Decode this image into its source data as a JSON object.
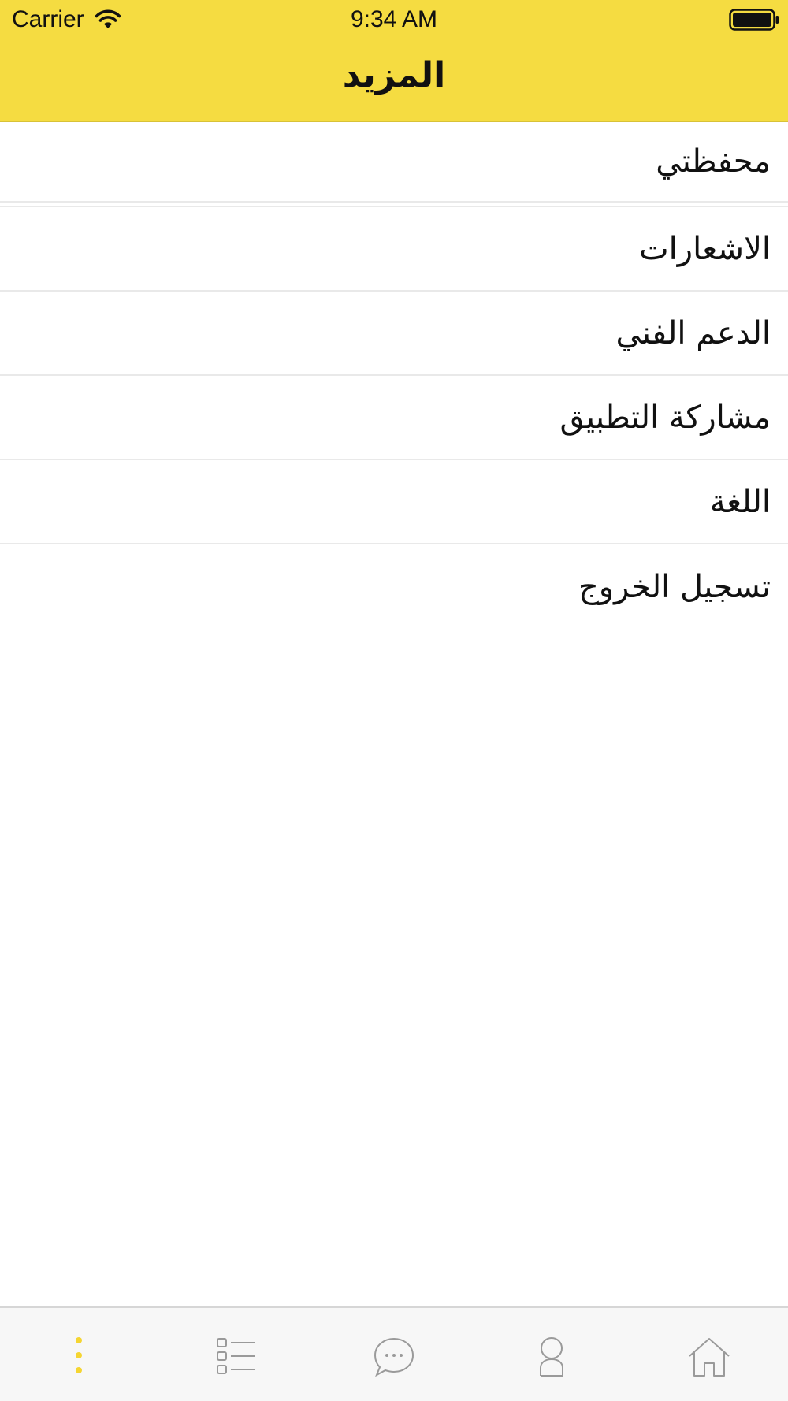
{
  "status_bar": {
    "carrier": "Carrier",
    "time": "9:34 AM",
    "icons": [
      "wifi-icon",
      "battery-icon"
    ]
  },
  "header": {
    "title": "المزيد",
    "background_color": "#f5dc41"
  },
  "menu": {
    "items": [
      {
        "label": "محفظتي"
      },
      {
        "label": "الاشعارات"
      },
      {
        "label": "الدعم الفني"
      },
      {
        "label": "مشاركة التطبيق"
      },
      {
        "label": "اللغة"
      },
      {
        "label": "تسجيل الخروج"
      }
    ]
  },
  "tab_bar": {
    "tabs": [
      {
        "icon": "more-dots-icon",
        "active": true
      },
      {
        "icon": "list-icon",
        "active": false
      },
      {
        "icon": "chat-bubble-icon",
        "active": false
      },
      {
        "icon": "profile-icon",
        "active": false
      },
      {
        "icon": "home-icon",
        "active": false
      }
    ],
    "active_color": "#f5d531",
    "inactive_color": "#9a9a9a"
  }
}
